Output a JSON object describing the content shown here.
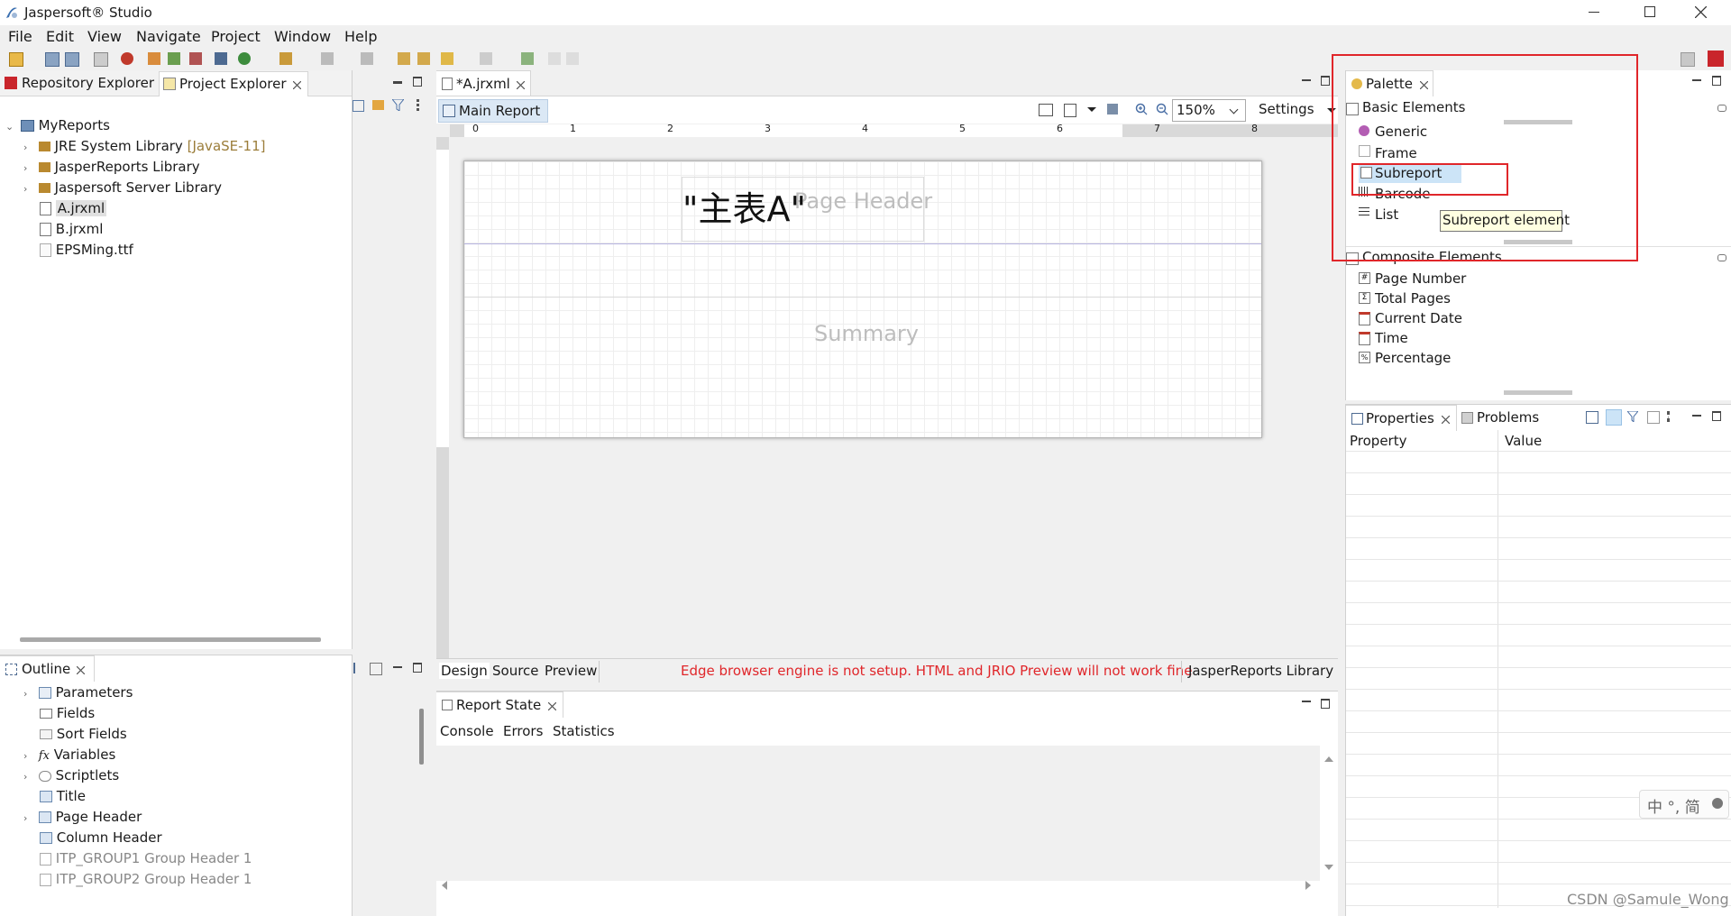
{
  "window": {
    "title": "Jaspersoft® Studio"
  },
  "menu": [
    "File",
    "Edit",
    "View",
    "Navigate",
    "Project",
    "Window",
    "Help"
  ],
  "left_panel": {
    "tabs": [
      "Repository Explorer",
      "Project Explorer"
    ],
    "tree": {
      "root": "MyReports",
      "items": [
        {
          "label": "JRE System Library",
          "suffix": "[JavaSE-11]"
        },
        {
          "label": "JasperReports Library"
        },
        {
          "label": "Jaspersoft Server Library"
        },
        {
          "label": "A.jrxml"
        },
        {
          "label": "B.jrxml"
        },
        {
          "label": "EPSMing.ttf"
        }
      ]
    }
  },
  "outline": {
    "title": "Outline",
    "items": [
      "Parameters",
      "Fields",
      "Sort Fields",
      "Variables",
      "Scriptlets",
      "Title",
      "Page Header",
      "Column Header",
      "ITP_GROUP1 Group Header 1",
      "ITP_GROUP2 Group Header 1"
    ]
  },
  "editor": {
    "tab": "*A.jrxml",
    "subtab": "Main Report",
    "zoom": "150%",
    "settings": "Settings",
    "ruler": [
      "0",
      "1",
      "2",
      "3",
      "4",
      "5",
      "6",
      "7",
      "8"
    ],
    "canvas": {
      "title_text": "\"主表A\"",
      "page_header": "Page Header",
      "summary": "Summary"
    },
    "bottom_tabs": [
      "Design",
      "Source",
      "Preview"
    ],
    "warning": "Edge browser engine is not setup. HTML and JRIO Preview will not work fine",
    "library_label": "JasperReports Library"
  },
  "report_state": {
    "title": "Report State",
    "tabs": [
      "Console",
      "Errors",
      "Statistics"
    ]
  },
  "palette": {
    "title": "Palette",
    "basic_title": "Basic Elements",
    "basic": [
      "Generic",
      "Frame",
      "Subreport",
      "Barcode",
      "List"
    ],
    "tooltip": "Subreport element",
    "composite_title": "Composite Elements",
    "composite": [
      "Page Number",
      "Total Pages",
      "Current Date",
      "Time",
      "Percentage"
    ]
  },
  "properties": {
    "tabs": [
      "Properties",
      "Problems"
    ],
    "col_property": "Property",
    "col_value": "Value"
  },
  "ime": {
    "text": "中 °, 简"
  },
  "watermark": "CSDN @Samule_Wong",
  "colors": {
    "highlight_red": "#e0262a",
    "warning_red": "#e0262a",
    "selection_blue": "#cce4f7"
  }
}
